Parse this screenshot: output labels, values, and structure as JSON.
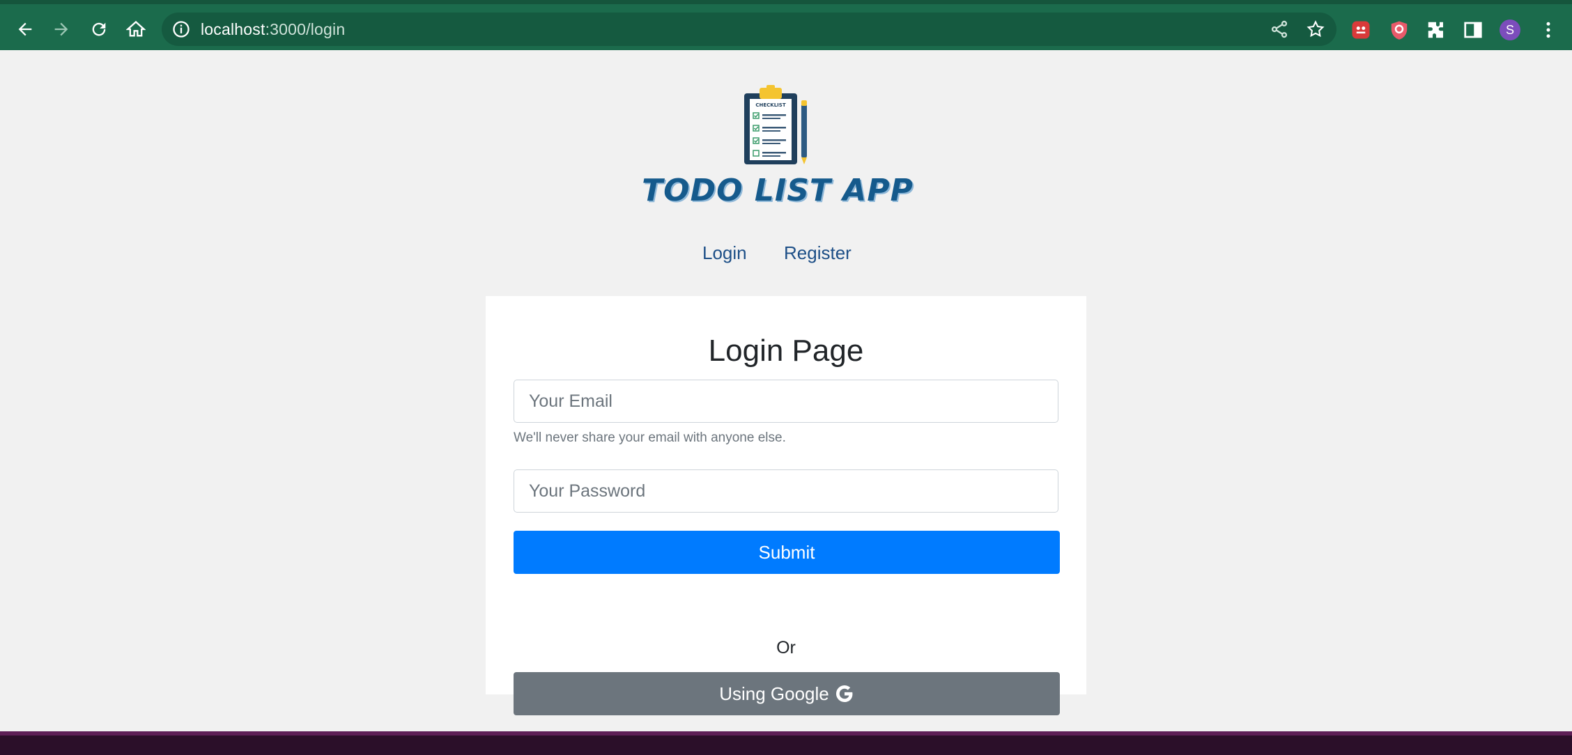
{
  "browser": {
    "url_host": "localhost",
    "url_path": ":3000/login",
    "profile_initial": "S",
    "icons": [
      "back-icon",
      "forward-icon",
      "reload-icon",
      "home-icon",
      "info-icon",
      "share-icon",
      "bookmark-star-icon",
      "extension-icon",
      "shield-extension-icon",
      "puzzle-icon",
      "side-panel-icon",
      "menu-icon"
    ]
  },
  "header": {
    "logo_icon": "clipboard-checklist-icon",
    "logo_text": "CHECKLIST",
    "title": "TODO LIST APP"
  },
  "nav": {
    "login": "Login",
    "register": "Register"
  },
  "form": {
    "title": "Login Page",
    "email_placeholder": "Your Email",
    "email_help": "We'll never share your email with anyone else.",
    "password_placeholder": "Your Password",
    "submit_label": "Submit",
    "or_label": "Or",
    "google_label": "Using Google",
    "google_icon": "google-g-icon"
  },
  "colors": {
    "toolbar": "#1b6b4c",
    "primary": "#007bff",
    "secondary": "#6c757d",
    "title": "#155a8c"
  }
}
